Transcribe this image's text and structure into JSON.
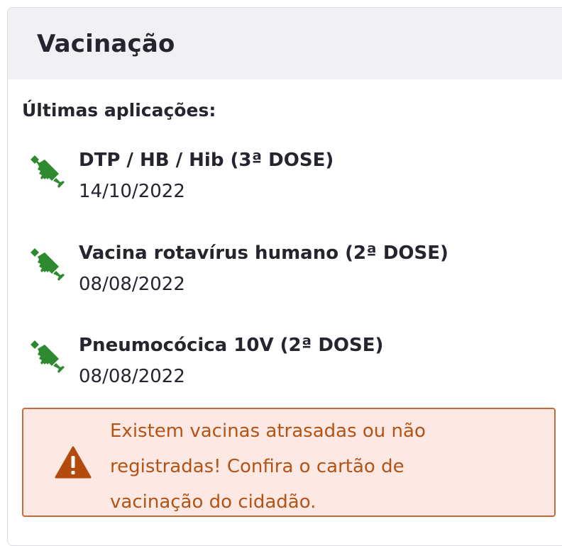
{
  "card": {
    "title": "Vacinação"
  },
  "section": {
    "label": "Últimas aplicações:"
  },
  "vaccines": [
    {
      "name": "DTP / HB / Hib (3ª DOSE)",
      "date": "14/10/2022",
      "icon": "syringe-icon"
    },
    {
      "name": "Vacina rotavírus humano (2ª DOSE)",
      "date": "08/08/2022",
      "icon": "syringe-icon"
    },
    {
      "name": "Pneumocócica 10V (2ª DOSE)",
      "date": "08/08/2022",
      "icon": "syringe-icon"
    }
  ],
  "alert": {
    "message": "Existem vacinas atrasadas ou não registradas! Confira o cartão de vacinação do cidadão.",
    "icon": "warning-icon"
  },
  "colors": {
    "header_bg": "#f0f0f5",
    "syringe": "#2e8a2e",
    "alert_bg": "#fde8e4",
    "alert_border": "#c86b3a",
    "alert_text": "#b35316",
    "warning_icon": "#b34a0e"
  }
}
